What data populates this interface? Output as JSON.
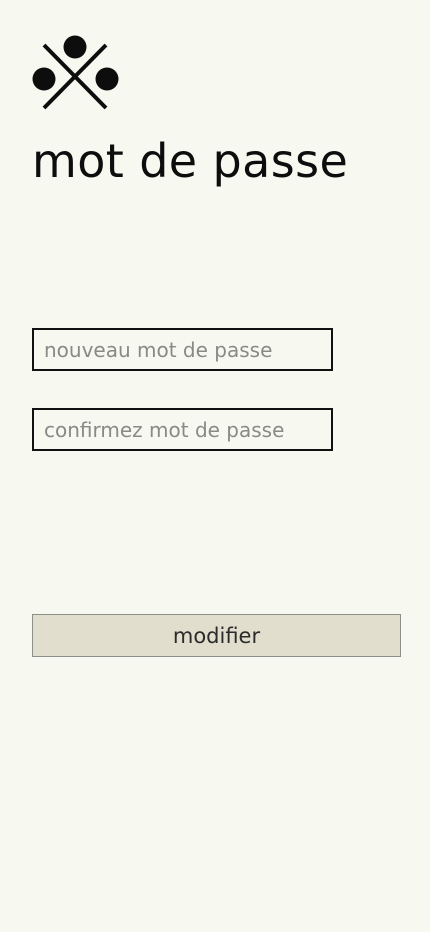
{
  "app": {
    "logo_icon": "three-dots-cross-icon"
  },
  "page": {
    "title": "mot de passe"
  },
  "form": {
    "new_password_placeholder": "nouveau mot de passe",
    "new_password_value": "",
    "confirm_password_placeholder": "confirmez mot de passe",
    "confirm_password_value": "",
    "submit_label": "modifier"
  },
  "colors": {
    "background": "#f7f8f0",
    "text": "#0d0d0d",
    "placeholder": "#8a8a85",
    "field_border": "#111111",
    "button_background": "#e2dece",
    "button_border": "#8f8f8a"
  }
}
